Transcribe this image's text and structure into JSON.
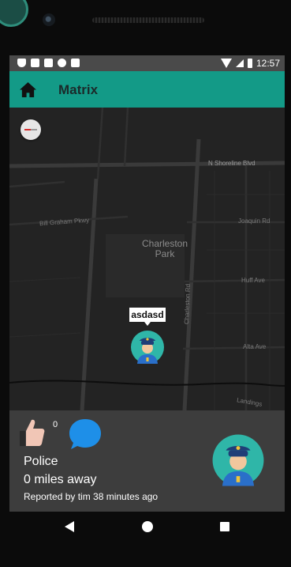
{
  "status_bar": {
    "time": "12:57"
  },
  "app_bar": {
    "title": "Matrix"
  },
  "map": {
    "streets": {
      "n_shoreline": "N Shoreline Blvd",
      "bill_graham": "Bill Graham Pkwy",
      "joaquin": "Joaquin Rd",
      "huff": "Huff Ave",
      "charleston_rd": "Charleston Rd",
      "alta": "Alta Ave",
      "landings": "Landings"
    },
    "park_line1": "Charleston",
    "park_line2": "Park",
    "marker_label": "asdasd"
  },
  "report": {
    "like_count": "0",
    "category": "Police",
    "distance": "0 miles away",
    "reported_by": "Reported by tim 38 minutes ago"
  },
  "colors": {
    "accent": "#139a87",
    "panel": "#3d3d3d",
    "comment": "#1e8fe8",
    "avatar_bg": "#2fb6a8"
  },
  "icons": [
    "home-icon",
    "compass-icon",
    "thumbs-up-icon",
    "comment-icon",
    "police-avatar-icon",
    "back-icon",
    "circle-home-icon",
    "recent-apps-icon"
  ]
}
